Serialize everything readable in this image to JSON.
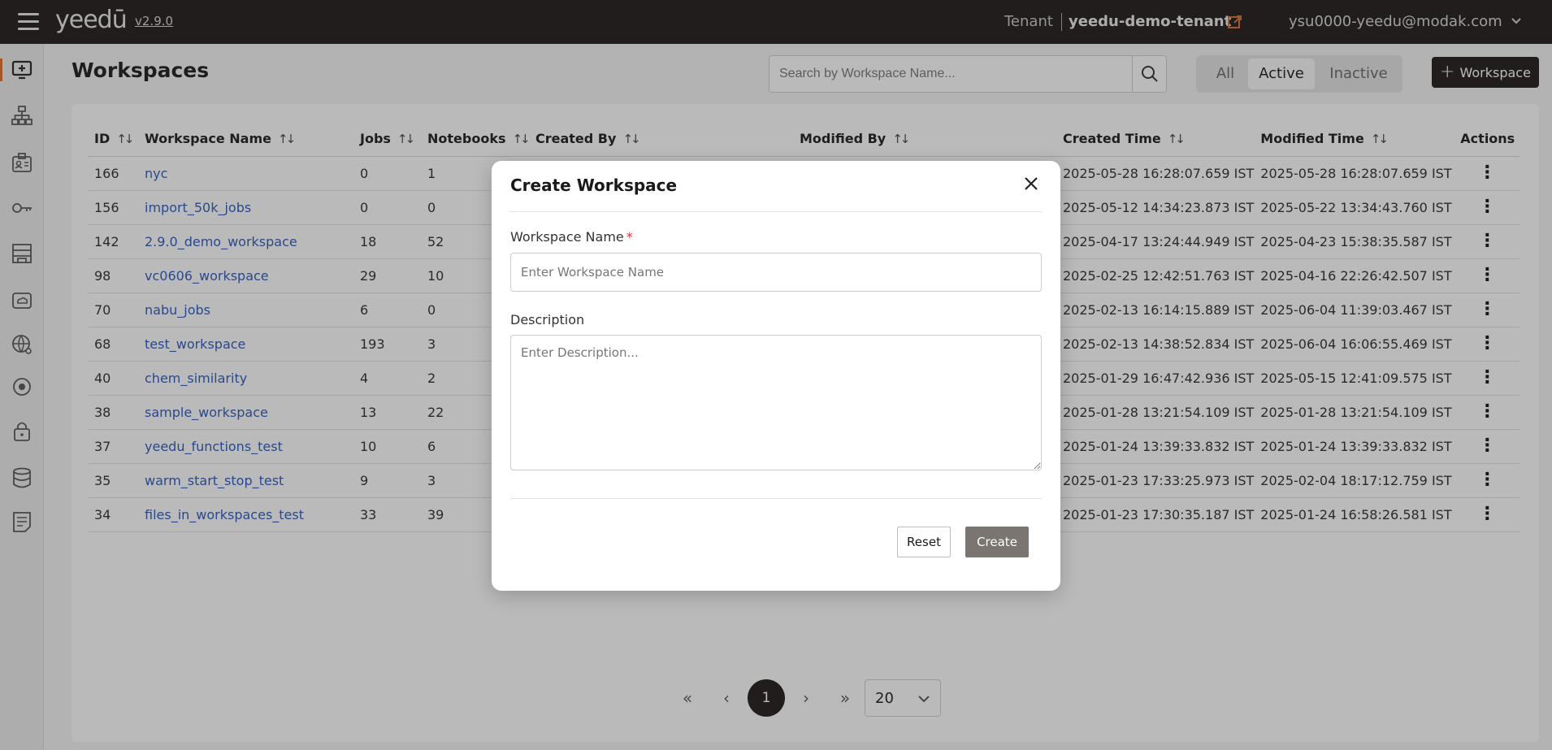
{
  "header": {
    "app_name": "yeedū",
    "version": "v2.9.0",
    "tenant_label": "Tenant",
    "tenant_name": "yeedu-demo-tenant",
    "user_email": "ysu0000-yeedu@modak.com"
  },
  "sidebar": {
    "items": [
      {
        "icon": "workspace-monitor-icon",
        "active": true
      },
      {
        "icon": "hierarchy-icon",
        "active": false
      },
      {
        "icon": "id-badge-icon",
        "active": false
      },
      {
        "icon": "key-icon",
        "active": false
      },
      {
        "icon": "building-icon",
        "active": false
      },
      {
        "icon": "cloud-drive-icon",
        "active": false
      },
      {
        "icon": "globe-settings-icon",
        "active": false
      },
      {
        "icon": "target-icon",
        "active": false
      },
      {
        "icon": "lock-icon",
        "active": false
      },
      {
        "icon": "database-icon",
        "active": false
      },
      {
        "icon": "notes-icon",
        "active": false
      }
    ]
  },
  "page": {
    "title": "Workspaces",
    "search_placeholder": "Search by Workspace Name...",
    "filters": [
      "All",
      "Active",
      "Inactive"
    ],
    "active_filter": "Active",
    "add_button": "Workspace"
  },
  "table": {
    "columns": [
      "ID",
      "Workspace Name",
      "Jobs",
      "Notebooks",
      "Created By",
      "Modified By",
      "Created Time",
      "Modified Time",
      "Actions"
    ],
    "rows": [
      {
        "id": "166",
        "name": "nyc",
        "jobs": "0",
        "notebooks": "1",
        "created_time": "2025-05-28 16:28:07.659 IST",
        "modified_time": "2025-05-28 16:28:07.659 IST"
      },
      {
        "id": "156",
        "name": "import_50k_jobs",
        "jobs": "0",
        "notebooks": "0",
        "created_time": "2025-05-12 14:34:23.873 IST",
        "modified_time": "2025-05-22 13:34:43.760 IST"
      },
      {
        "id": "142",
        "name": "2.9.0_demo_workspace",
        "jobs": "18",
        "notebooks": "52",
        "created_time": "2025-04-17 13:24:44.949 IST",
        "modified_time": "2025-04-23 15:38:35.587 IST"
      },
      {
        "id": "98",
        "name": "vc0606_workspace",
        "jobs": "29",
        "notebooks": "10",
        "created_time": "2025-02-25 12:42:51.763 IST",
        "modified_time": "2025-04-16 22:26:42.507 IST"
      },
      {
        "id": "70",
        "name": "nabu_jobs",
        "jobs": "6",
        "notebooks": "0",
        "created_time": "2025-02-13 16:14:15.889 IST",
        "modified_time": "2025-06-04 11:39:03.467 IST"
      },
      {
        "id": "68",
        "name": "test_workspace",
        "jobs": "193",
        "notebooks": "3",
        "created_time": "2025-02-13 14:38:52.834 IST",
        "modified_time": "2025-06-04 16:06:55.469 IST"
      },
      {
        "id": "40",
        "name": "chem_similarity",
        "jobs": "4",
        "notebooks": "2",
        "created_time": "2025-01-29 16:47:42.936 IST",
        "modified_time": "2025-05-15 12:41:09.575 IST"
      },
      {
        "id": "38",
        "name": "sample_workspace",
        "jobs": "13",
        "notebooks": "22",
        "created_time": "2025-01-28 13:21:54.109 IST",
        "modified_time": "2025-01-28 13:21:54.109 IST"
      },
      {
        "id": "37",
        "name": "yeedu_functions_test",
        "jobs": "10",
        "notebooks": "6",
        "created_time": "2025-01-24 13:39:33.832 IST",
        "modified_time": "2025-01-24 13:39:33.832 IST"
      },
      {
        "id": "35",
        "name": "warm_start_stop_test",
        "jobs": "9",
        "notebooks": "3",
        "created_time": "2025-01-23 17:33:25.973 IST",
        "modified_time": "2025-02-04 18:17:12.759 IST"
      },
      {
        "id": "34",
        "name": "files_in_workspaces_test",
        "jobs": "33",
        "notebooks": "39",
        "created_time": "2025-01-23 17:30:35.187 IST",
        "modified_time": "2025-01-24 16:58:26.581 IST"
      }
    ]
  },
  "pagination": {
    "current_page": "1",
    "page_size": "20"
  },
  "modal": {
    "title": "Create Workspace",
    "name_label": "Workspace Name",
    "name_required_mark": "*",
    "name_placeholder": "Enter Workspace Name",
    "name_value": "",
    "description_label": "Description",
    "description_placeholder": "Enter Description...",
    "description_value": "",
    "reset_label": "Reset",
    "create_label": "Create"
  },
  "colors": {
    "topbar": "#1c1917",
    "accent": "#e26d2b",
    "link": "#2b58b8",
    "required": "#e03131",
    "create_button": "#7a7571"
  }
}
